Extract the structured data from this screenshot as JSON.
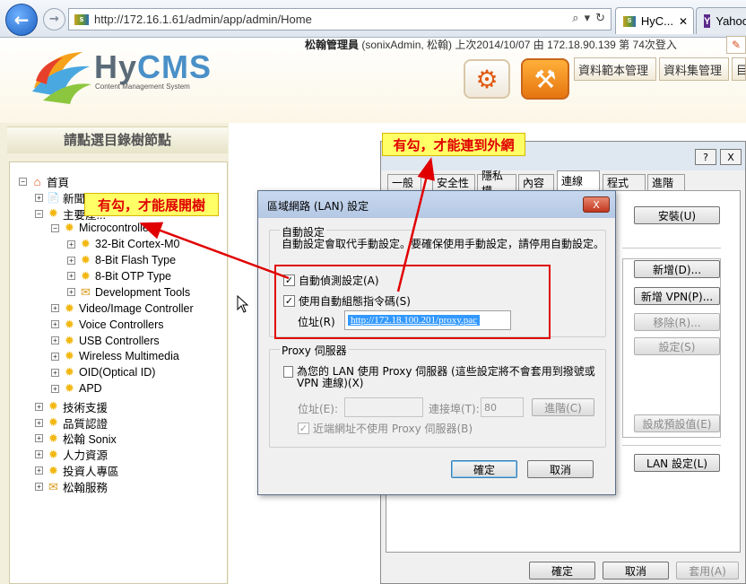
{
  "browser": {
    "url": "http://172.16.1.61/admin/app/admin/Home",
    "tabs": [
      {
        "label": "HyC..."
      },
      {
        "label": "Yahoo"
      }
    ]
  },
  "header": {
    "logo_text_hy": "Hy",
    "logo_text_cms": "CMS",
    "logo_subtitle": "Content Management System",
    "user_name": "松翰管理員",
    "user_info": "(sonixAdmin, 松翰) 上次2014/10/07 由 172.18.90.139 第 74次登入",
    "top_buttons": [
      "資料範本管理",
      "資料集管理",
      "目"
    ]
  },
  "sidebar": {
    "title": "請點選目錄樹節點",
    "tree": [
      {
        "label": "首頁",
        "icon": "home-icon",
        "depth": 0,
        "expander": "−"
      },
      {
        "label": "新聞/...",
        "icon": "doc-icon",
        "depth": 1,
        "expander": "+"
      },
      {
        "label": "主要產...",
        "icon": "sun-icon",
        "depth": 1,
        "expander": "−"
      },
      {
        "label": "Microcontrollers",
        "icon": "sun-icon",
        "depth": 2,
        "expander": "−"
      },
      {
        "label": "32-Bit Cortex-M0",
        "icon": "sun-icon",
        "depth": 3,
        "expander": "+"
      },
      {
        "label": "8-Bit Flash Type",
        "icon": "sun-icon",
        "depth": 3,
        "expander": "+"
      },
      {
        "label": "8-Bit OTP Type",
        "icon": "sun-icon",
        "depth": 3,
        "expander": "+"
      },
      {
        "label": "Development Tools",
        "icon": "envelope-icon",
        "depth": 3,
        "expander": "+"
      },
      {
        "label": "Video/Image Controller",
        "icon": "sun-icon",
        "depth": 2,
        "expander": "+"
      },
      {
        "label": "Voice Controllers",
        "icon": "sun-icon",
        "depth": 2,
        "expander": "+"
      },
      {
        "label": "USB Controllers",
        "icon": "sun-icon",
        "depth": 2,
        "expander": "+"
      },
      {
        "label": "Wireless Multimedia",
        "icon": "sun-icon",
        "depth": 2,
        "expander": "+"
      },
      {
        "label": "OID(Optical ID)",
        "icon": "sun-icon",
        "depth": 2,
        "expander": "+"
      },
      {
        "label": "APD",
        "icon": "sun-icon",
        "depth": 2,
        "expander": "+"
      },
      {
        "label": "技術支援",
        "icon": "sun-icon",
        "depth": 1,
        "expander": "+"
      },
      {
        "label": "品質認證",
        "icon": "sun-icon",
        "depth": 1,
        "expander": "+"
      },
      {
        "label": "松翰 Sonix",
        "icon": "sun-icon",
        "depth": 1,
        "expander": "+"
      },
      {
        "label": "人力資源",
        "icon": "sun-icon",
        "depth": 1,
        "expander": "+"
      },
      {
        "label": "投資人專區",
        "icon": "sun-icon",
        "depth": 1,
        "expander": "+"
      },
      {
        "label": "松翰服務",
        "icon": "envelope-icon",
        "depth": 1,
        "expander": "+"
      }
    ]
  },
  "internet_options": {
    "help": "?",
    "close": "X",
    "tabs": [
      "一般",
      "安全性",
      "隱私權",
      "內容",
      "連線",
      "程式",
      "進階"
    ],
    "active_tab": "連線",
    "buttons": {
      "install": "安裝(U)",
      "add": "新增(D)...",
      "add_vpn": "新增 VPN(P)...",
      "remove": "移除(R)...",
      "settings": "設定(S)",
      "set_default": "設成預設值(E)",
      "lan_settings": "LAN 設定(L)",
      "ok": "確定",
      "cancel": "取消",
      "apply": "套用(A)"
    }
  },
  "lan_dialog": {
    "title": "區域網路 (LAN) 設定",
    "close": "X",
    "auto_group": "自動設定",
    "auto_desc": "自動設定會取代手動設定。要確保使用手動設定，請停用自動設定。",
    "auto_detect": {
      "label": "自動偵測設定(A)",
      "checked": true
    },
    "use_script": {
      "label": "使用自動組態指令碼(S)",
      "checked": true
    },
    "address_label": "位址(R)",
    "address_value": "http://172.18.100.201/proxy.pac",
    "proxy_group": "Proxy 伺服器",
    "use_proxy": {
      "label": "為您的 LAN 使用 Proxy 伺服器 (這些設定將不會套用到撥號或 VPN 連線)(X)",
      "checked": false
    },
    "proxy_address_label": "位址(E):",
    "port_label": "連接埠(T):",
    "port_value": "80",
    "advanced": "進階(C)",
    "bypass_local": {
      "label": "近端網址不使用 Proxy 伺服器(B)",
      "checked": true
    },
    "ok": "確定",
    "cancel": "取消"
  },
  "annotations": {
    "callout_tree": "有勾，才能展開樹",
    "callout_network": "有勾，才能連到外網",
    "color": "#e00000"
  }
}
